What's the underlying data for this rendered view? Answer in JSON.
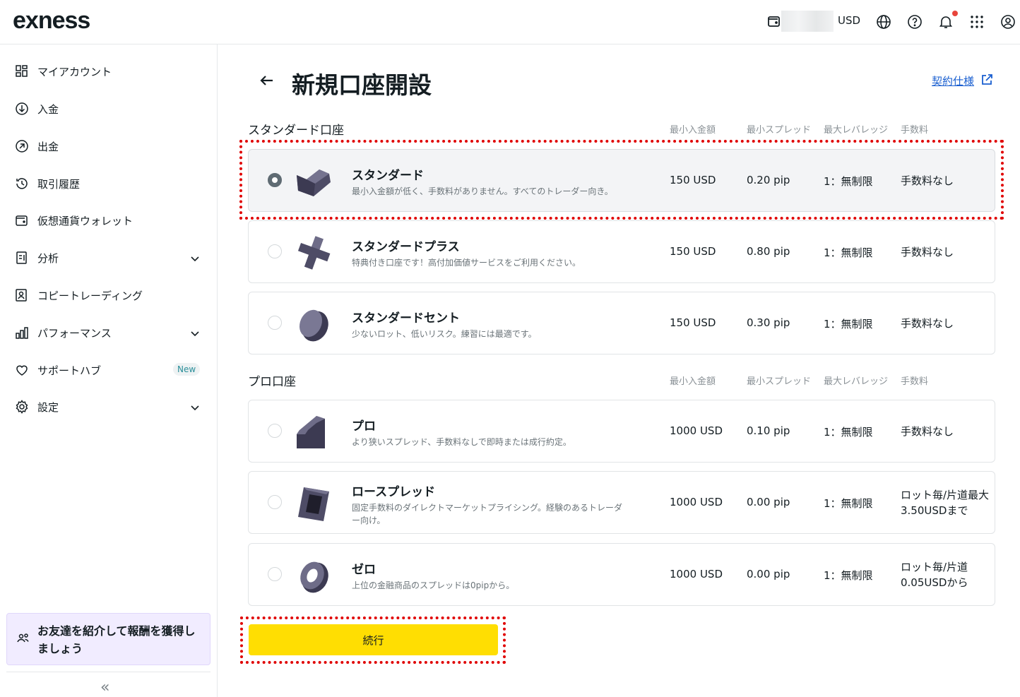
{
  "header": {
    "logo": "exness",
    "currency": "USD",
    "icons": [
      "wallet-icon",
      "globe-icon",
      "help-icon",
      "bell-icon",
      "apps-grid-icon",
      "profile-icon"
    ]
  },
  "sidebar": {
    "items": [
      {
        "label": "マイアカウント",
        "icon": "dashboard-icon"
      },
      {
        "label": "入金",
        "icon": "deposit-icon"
      },
      {
        "label": "出金",
        "icon": "withdraw-icon"
      },
      {
        "label": "取引履歴",
        "icon": "history-icon"
      },
      {
        "label": "仮想通貨ウォレット",
        "icon": "wallet-icon"
      },
      {
        "label": "分析",
        "icon": "analytics-icon"
      },
      {
        "label": "コピートレーディング",
        "icon": "copy-trading-icon"
      },
      {
        "label": "パフォーマンス",
        "icon": "performance-icon"
      },
      {
        "label": "サポートハブ",
        "icon": "heart-icon",
        "badge": "New"
      },
      {
        "label": "設定",
        "icon": "settings-icon"
      }
    ],
    "promo": "お友達を紹介して報酬を獲得しましょう",
    "collapse": "«"
  },
  "main": {
    "title": "新規口座開設",
    "spec_link": "契約仕様",
    "columns": [
      "最小入金額",
      "最小スプレッド",
      "最大レバレッジ",
      "手数料"
    ],
    "sections": [
      {
        "title": "スタンダード口座",
        "accounts": [
          {
            "name": "スタンダード",
            "desc": "最小入金額が低く、手数料がありません。すべてのトレーダー向き。",
            "deposit": "150 USD",
            "spread": "0.20 pip",
            "leverage": "1：無制限",
            "fee": "手数料なし",
            "selected": true
          },
          {
            "name": "スタンダードプラス",
            "desc": "特典付き口座です！高付加価値サービスをご利用ください。",
            "deposit": "150 USD",
            "spread": "0.80 pip",
            "leverage": "1：無制限",
            "fee": "手数料なし",
            "selected": false
          },
          {
            "name": "スタンダードセント",
            "desc": "少ないロット、低いリスク。練習には最適です。",
            "deposit": "150 USD",
            "spread": "0.30 pip",
            "leverage": "1：無制限",
            "fee": "手数料なし",
            "selected": false
          }
        ]
      },
      {
        "title": "プロ口座",
        "accounts": [
          {
            "name": "プロ",
            "desc": "より狭いスプレッド、手数料なしで即時または成行約定。",
            "deposit": "1000 USD",
            "spread": "0.10 pip",
            "leverage": "1：無制限",
            "fee": "手数料なし",
            "selected": false
          },
          {
            "name": "ロースプレッド",
            "desc": "固定手数料のダイレクトマーケットプライシング。経験のあるトレーダー向け。",
            "deposit": "1000 USD",
            "spread": "0.00 pip",
            "leverage": "1：無制限",
            "fee": "ロット毎/片道最大3.50USDまで",
            "selected": false
          },
          {
            "name": "ゼロ",
            "desc": "上位の金融商品のスプレッドは0pipから。",
            "deposit": "1000 USD",
            "spread": "0.00 pip",
            "leverage": "1：無制限",
            "fee": "ロット毎/片道0.05USDから",
            "selected": false
          }
        ]
      }
    ],
    "continue_label": "続行"
  },
  "colors": {
    "accent": "#ffde02",
    "link": "#1a5fd0",
    "highlight": "#e00000",
    "promo_bg": "#f1ecff"
  }
}
